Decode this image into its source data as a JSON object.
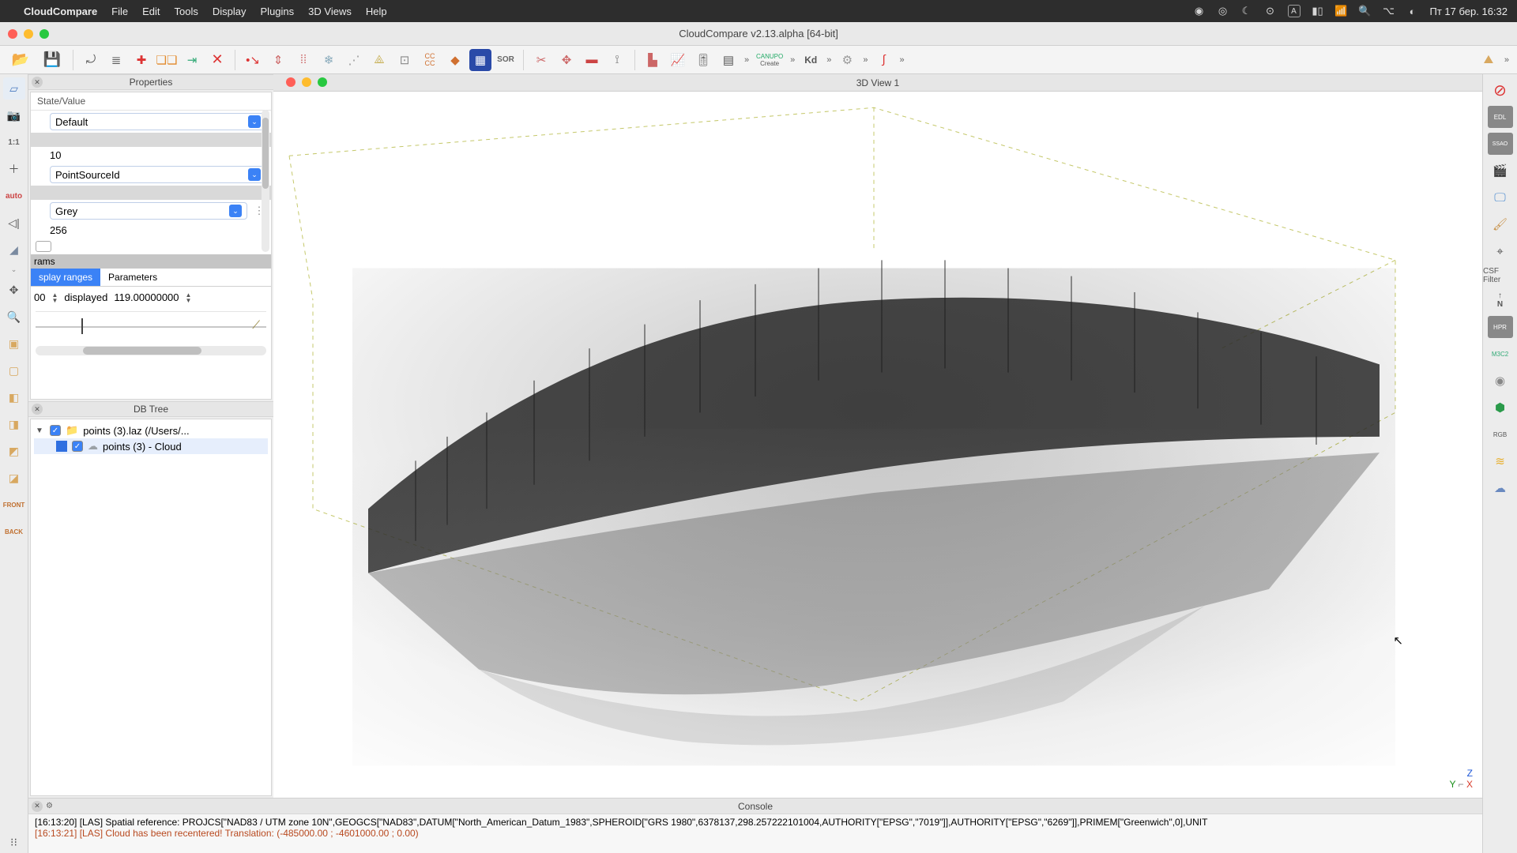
{
  "menubar": {
    "appname": "CloudCompare",
    "items": [
      "File",
      "Edit",
      "Tools",
      "Display",
      "Plugins",
      "3D Views",
      "Help"
    ],
    "clock": "Пт 17 бер. 16:32"
  },
  "window": {
    "title": "CloudCompare v2.13.alpha [64-bit]"
  },
  "toolbar_labels": {
    "sor": "SOR",
    "cc": "CC\nCC",
    "canupo_top": "CANUPO",
    "canupo_bottom": "Create",
    "kd": "Kd"
  },
  "panels": {
    "properties": {
      "title": "Properties",
      "state_header": "State/Value",
      "default_value": "Default",
      "ten": "10",
      "active_sf": "PointSourceId",
      "colorscale": "Grey",
      "steps": "256",
      "rams": "rams",
      "tabs": {
        "display": "splay ranges",
        "params": "Parameters"
      },
      "range_left": "00",
      "displayed": "displayed",
      "range_right": "119.00000000"
    },
    "dbtree": {
      "title": "DB Tree",
      "root": "points (3).laz (/Users/...",
      "child": "points (3) - Cloud"
    }
  },
  "view": {
    "title": "3D View 1",
    "axes": {
      "z": "Z",
      "y": "Y",
      "x": "X"
    }
  },
  "rightrail": {
    "csf": "CSF Filter",
    "n": "N"
  },
  "leftrail": {
    "one_one": "1:1",
    "auto": "auto",
    "front": "FRONT",
    "back": "BACK"
  },
  "console": {
    "title": "Console",
    "line1": "[16:13:20] [LAS] Spatial reference: PROJCS[\"NAD83 / UTM zone 10N\",GEOGCS[\"NAD83\",DATUM[\"North_American_Datum_1983\",SPHEROID[\"GRS 1980\",6378137,298.257222101004,AUTHORITY[\"EPSG\",\"7019\"]],AUTHORITY[\"EPSG\",\"6269\"]],PRIMEM[\"Greenwich\",0],UNIT",
    "line2": "[16:13:21] [LAS] Cloud has been recentered! Translation: (-485000.00 ; -4601000.00 ; 0.00)"
  }
}
